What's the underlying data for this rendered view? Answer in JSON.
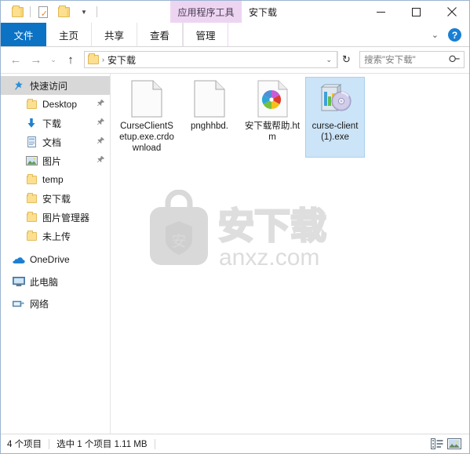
{
  "window": {
    "title": "安下载",
    "contextual_tab_group": "应用程序工具",
    "minimize_label": "最小化",
    "maximize_label": "最大化",
    "close_label": "关闭"
  },
  "quick_access_toolbar": {
    "items": [
      {
        "name": "properties",
        "icon": "folder-icon"
      },
      {
        "name": "new-folder",
        "icon": "document-check-icon"
      },
      {
        "name": "folder",
        "icon": "folder-icon"
      },
      {
        "name": "customize",
        "icon": "chevron-down-icon"
      }
    ]
  },
  "ribbon": {
    "tabs": [
      {
        "label": "文件",
        "active": true,
        "kind": "file"
      },
      {
        "label": "主页",
        "active": false,
        "kind": "normal"
      },
      {
        "label": "共享",
        "active": false,
        "kind": "normal"
      },
      {
        "label": "查看",
        "active": false,
        "kind": "normal"
      },
      {
        "label": "管理",
        "active": false,
        "kind": "contextual"
      }
    ],
    "expand_caret": "⌄",
    "help_label": "?"
  },
  "addressbar": {
    "back_label": "←",
    "forward_label": "→",
    "history_label": "⌄",
    "up_label": "↑",
    "path_text": "安下载",
    "path_separator": "›",
    "path_caret": "⌄",
    "refresh_label": "↻",
    "search_placeholder": "搜索\"安下载\"",
    "search_value": "",
    "search_icon": "search-icon"
  },
  "sidebar": {
    "items": [
      {
        "label": "快速访问",
        "icon": "star-pin-icon",
        "level": 0,
        "selected": true,
        "pinned": false
      },
      {
        "label": "Desktop",
        "icon": "folder-icon",
        "level": 1,
        "selected": false,
        "pinned": true
      },
      {
        "label": "下载",
        "icon": "download-arrow-icon",
        "level": 1,
        "selected": false,
        "pinned": true
      },
      {
        "label": "文档",
        "icon": "documents-icon",
        "level": 1,
        "selected": false,
        "pinned": true
      },
      {
        "label": "图片",
        "icon": "pictures-icon",
        "level": 1,
        "selected": false,
        "pinned": true
      },
      {
        "label": "temp",
        "icon": "folder-icon",
        "level": 1,
        "selected": false,
        "pinned": false
      },
      {
        "label": "安下载",
        "icon": "folder-icon",
        "level": 1,
        "selected": false,
        "pinned": false
      },
      {
        "label": "图片管理器",
        "icon": "folder-icon",
        "level": 1,
        "selected": false,
        "pinned": false
      },
      {
        "label": "未上传",
        "icon": "folder-icon",
        "level": 1,
        "selected": false,
        "pinned": false
      },
      {
        "label": "OneDrive",
        "icon": "cloud-icon",
        "level": 0,
        "selected": false,
        "pinned": false
      },
      {
        "label": "此电脑",
        "icon": "computer-icon",
        "level": 0,
        "selected": false,
        "pinned": false
      },
      {
        "label": "网络",
        "icon": "network-icon",
        "level": 0,
        "selected": false,
        "pinned": false
      }
    ],
    "pin_glyph": "📌"
  },
  "files": [
    {
      "name": "CurseClientSetup.exe.crdownload",
      "icon": "blank-document-icon",
      "selected": false
    },
    {
      "name": "pnghhbd.",
      "icon": "blank-document-icon",
      "selected": false
    },
    {
      "name": "安下载帮助.htm",
      "icon": "html-pinwheel-icon",
      "selected": false
    },
    {
      "name": "curse-client (1).exe",
      "icon": "installer-disc-icon",
      "selected": true
    }
  ],
  "watermark": {
    "brand_cn": "安下载",
    "brand_url": "anxz.com",
    "shield_char": "安",
    "color": "#d9d9d9"
  },
  "statusbar": {
    "item_count": "4 个项目",
    "selection": "选中 1 个项目  1.11 MB",
    "view_details_icon": "details-view-icon",
    "view_large_icon": "large-icons-view-icon"
  },
  "colors": {
    "file_tab": "#0b72c4",
    "contextual_group": "#edd5f2",
    "selection": "#cce4f7",
    "sidebar_selected": "#d8d8d8",
    "window_border": "#9ab4d0",
    "folder_yellow": "#fcdf8f"
  }
}
